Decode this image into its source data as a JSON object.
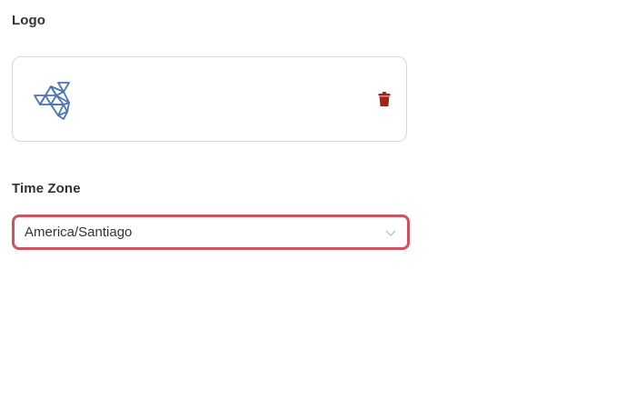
{
  "logo_section": {
    "label": "Logo",
    "logo_icon": "triangle-grid-logo",
    "delete_icon": "trash-icon",
    "delete_color": "#a02418"
  },
  "timezone_section": {
    "label": "Time Zone",
    "selected_value": "America/Santiago",
    "chevron_icon": "chevron-down-icon",
    "border_color": "#d0525c"
  }
}
